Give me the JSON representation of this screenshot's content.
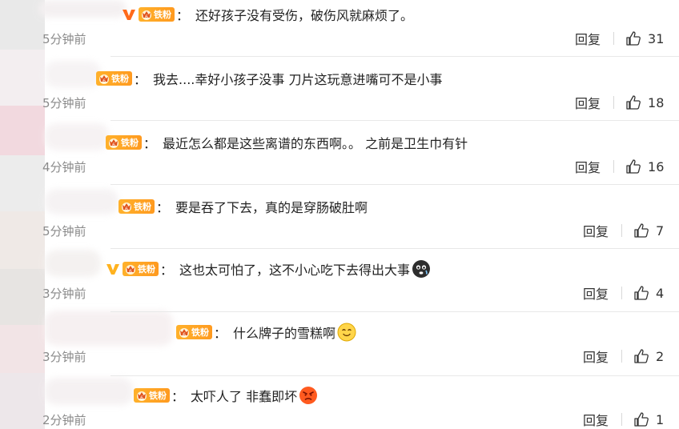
{
  "colors": {
    "badge": "#ff9a1f",
    "vip": "#ff6a1a",
    "text": "#222222",
    "muted": "#8a8a8a",
    "divider": "#e8e8e8"
  },
  "fan_badge_label": "铁粉",
  "reply_label": "回复",
  "comments": [
    {
      "text": "还好孩子没有受伤，破伤风就麻烦了。",
      "time": "5分钟前",
      "likes": "31",
      "vip": true,
      "emoji": ""
    },
    {
      "text": "我去....幸好小孩子没事 刀片这玩意进嘴可不是小事",
      "time": "5分钟前",
      "likes": "18",
      "vip": false,
      "emoji": ""
    },
    {
      "text": "最近怎么都是这些离谱的东西啊。。 之前是卫生巾有针",
      "time": "4分钟前",
      "likes": "16",
      "vip": false,
      "emoji": ""
    },
    {
      "text": "要是吞了下去，真的是穿肠破肚啊",
      "time": "5分钟前",
      "likes": "7",
      "vip": false,
      "emoji": ""
    },
    {
      "text": "这也太可怕了，这不小心吃下去得出大事",
      "time": "3分钟前",
      "likes": "4",
      "vip": true,
      "emoji": "scared-face-emoji"
    },
    {
      "text": "什么牌子的雪糕啊",
      "time": "3分钟前",
      "likes": "2",
      "vip": false,
      "emoji": "smile-face-emoji"
    },
    {
      "text": "太吓人了 非蠢即坏",
      "time": "2分钟前",
      "likes": "1",
      "vip": false,
      "emoji": "angry-face-emoji"
    }
  ]
}
